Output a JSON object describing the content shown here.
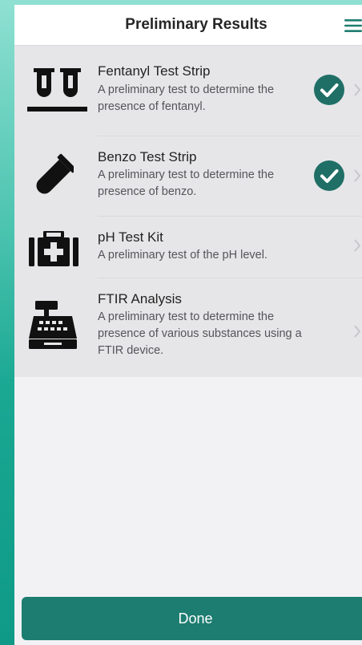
{
  "header": {
    "title": "Preliminary Results",
    "menu_icon": "hamburger-menu-icon"
  },
  "tests": [
    {
      "title": "Fentanyl Test Strip",
      "description": "A preliminary test to determine the presence of fentanyl.",
      "icon": "test-tubes-rack-icon",
      "completed": true
    },
    {
      "title": "Benzo Test Strip",
      "description": "A preliminary test to determine the presence of benzo.",
      "icon": "test-tube-icon",
      "completed": true
    },
    {
      "title": "pH Test Kit",
      "description": "A preliminary test of the pH level.",
      "icon": "medical-kit-icon",
      "completed": false
    },
    {
      "title": "FTIR Analysis",
      "description": "A preliminary test to determine the presence of various substances using a FTIR device.",
      "icon": "cash-register-icon",
      "completed": false
    }
  ],
  "footer": {
    "done_label": "Done"
  },
  "colors": {
    "accent": "#1d7d70",
    "check": "#1f6f66",
    "chevron": "#c7c7cc"
  }
}
